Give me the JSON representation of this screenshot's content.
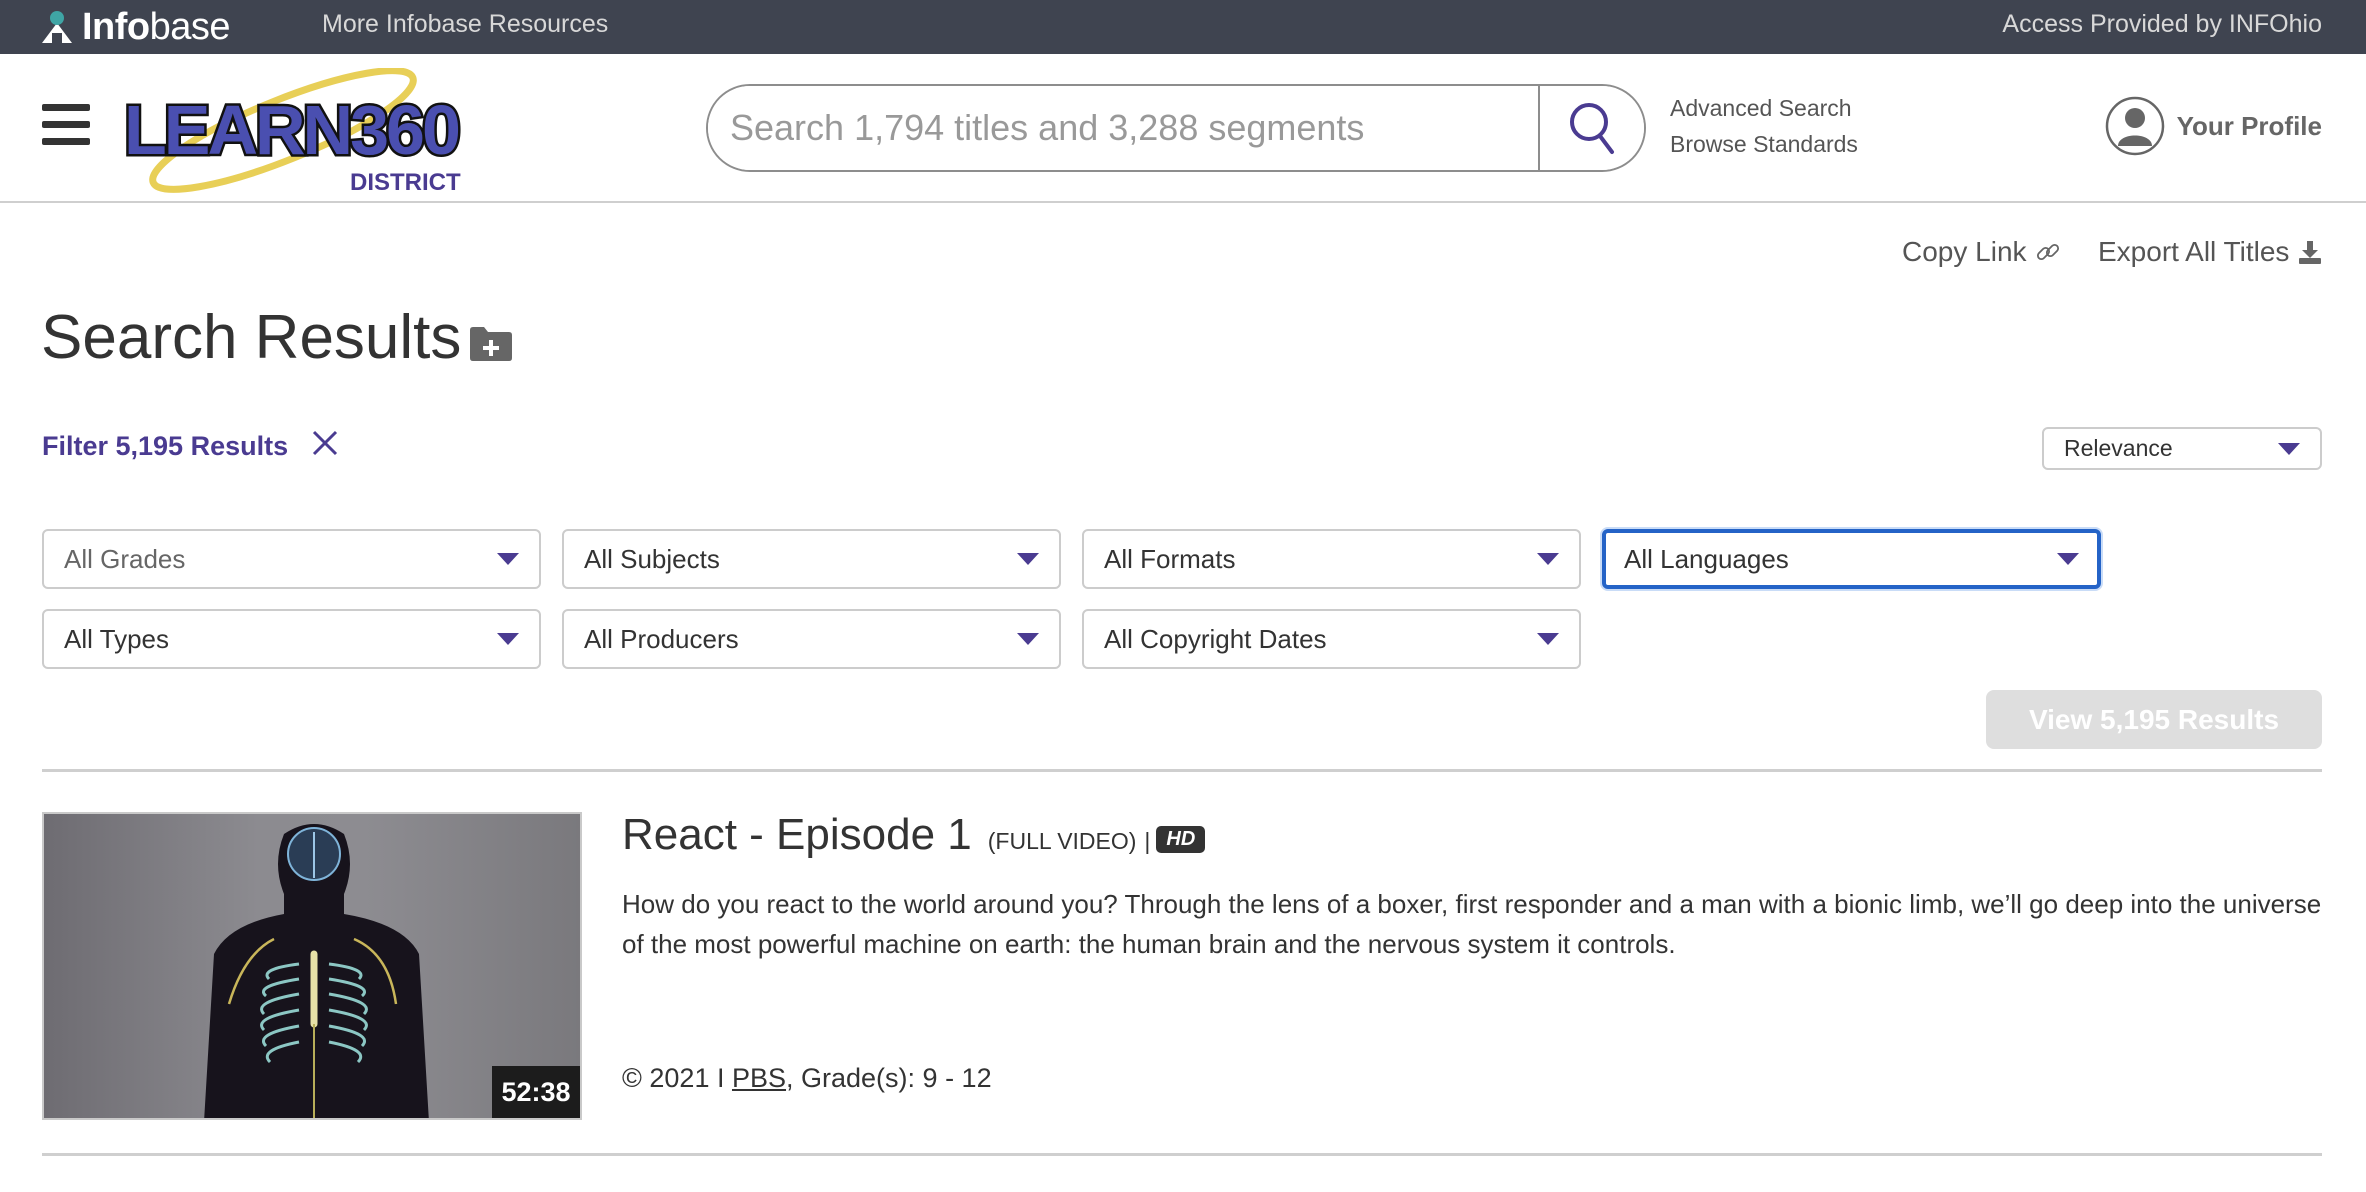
{
  "topbar": {
    "brand_bold": "Info",
    "brand_light": "base",
    "more_resources": "More Infobase Resources",
    "access": "Access Provided by INFOhio"
  },
  "header": {
    "logo_text": "LEARN360",
    "logo_sub": "DISTRICT",
    "search_placeholder": "Search 1,794 titles and 3,288 segments",
    "search_value": "",
    "advanced_search": "Advanced Search",
    "browse_standards": "Browse Standards",
    "profile_label": "Your Profile"
  },
  "actions": {
    "copy_link": "Copy Link",
    "export_all": "Export All Titles"
  },
  "page": {
    "title": "Search Results"
  },
  "filters": {
    "label": "Filter 5,195 Results",
    "sort": "Relevance",
    "selects": [
      {
        "value": "All Grades"
      },
      {
        "value": "All Subjects"
      },
      {
        "value": "All Formats"
      },
      {
        "value": "All Languages"
      },
      {
        "value": "All Types"
      },
      {
        "value": "All Producers"
      },
      {
        "value": "All Copyright Dates"
      }
    ],
    "view_button": "View 5,195 Results"
  },
  "results": [
    {
      "title": "React - Episode 1",
      "kind": "(FULL VIDEO)",
      "separator": "|",
      "badge": "HD",
      "duration": "52:38",
      "description": "How do you react to the world around you? Through the lens of a boxer, first responder and a man with a bionic limb, we’ll go deep into the universe of the most powerful machine on earth: the human brain and the nervous system it controls.",
      "meta_prefix": "© 2021 I",
      "producer": "PBS",
      "meta_suffix": ", Grade(s): 9 - 12"
    }
  ],
  "colors": {
    "topbar": "#3f4450",
    "accent_purple": "#4a3b91",
    "focus_blue": "#2463c7"
  }
}
